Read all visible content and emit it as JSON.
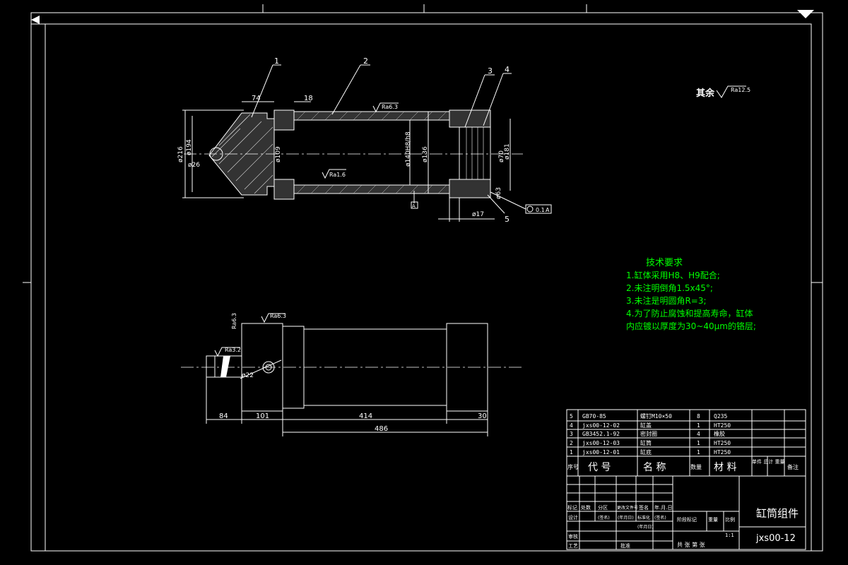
{
  "colors": {
    "background": "#000000",
    "line": "#ffffff",
    "leader": "#d0d0d0",
    "text": "#ffffff",
    "notes": "#00ff00"
  },
  "surface_note": {
    "label": "其余",
    "ra": "Ra12.5"
  },
  "balloons": [
    "1",
    "2",
    "3",
    "4",
    "5"
  ],
  "top_dims": [
    "74",
    "18"
  ],
  "diameters": {
    "d216": "ø216",
    "d194": "ø194",
    "d26": "ø26",
    "d109": "ø109",
    "d140": "ø140H8/h8",
    "d136": "ø136",
    "d70": "ø70",
    "d181": "ø181",
    "d17": "ø17",
    "d63": "ø63"
  },
  "roughness": {
    "r1": "Ra6.3",
    "r2": "Ra1.6",
    "r3": "Ra6.3",
    "r4": "Ra6.3",
    "r5": "Ra3.2"
  },
  "datum": {
    "letter": "A",
    "tolerance": "0.1",
    "ref": "A"
  },
  "bottom_dims": {
    "d22": "ø22",
    "l84": "84",
    "l101": "101",
    "l414": "414",
    "l486": "486",
    "l30": "30"
  },
  "tech_title": "技术要求",
  "tech_notes": [
    "1.缸体采用H8、H9配合;",
    "2.未注明倒角1.5x45°;",
    "3.未注是明圆角R=3;",
    "4.为了防止腐蚀和提高寿命，缸体",
    "   内应镀以厚度为30~40μm的铬层;"
  ],
  "bom_rows": [
    {
      "no": "5",
      "code": "GB70-85",
      "name": "螺钉M10×50",
      "qty": "8",
      "material": "Q235"
    },
    {
      "no": "4",
      "code": "jxs00-12-02",
      "name": "缸盖",
      "qty": "1",
      "material": "HT250"
    },
    {
      "no": "3",
      "code": "GB3452.1-92",
      "name": "密封圈",
      "qty": "4",
      "material": "橡胶"
    },
    {
      "no": "2",
      "code": "jxs00-12-03",
      "name": "缸筒",
      "qty": "1",
      "material": "HT250"
    },
    {
      "no": "1",
      "code": "jxs00-12-01",
      "name": "缸底",
      "qty": "1",
      "material": "HT250"
    }
  ],
  "bom_header": {
    "no": "序号",
    "code": "代  号",
    "name": "名  称",
    "qty": "数量",
    "material": "材  料",
    "weight": "单件 总计 重量",
    "remark": "备注"
  },
  "title_block": {
    "labels": [
      "标记",
      "处数",
      "分区",
      "更改文件号",
      "签名",
      "年.月.日"
    ],
    "labels2": [
      "设计",
      "(签名)",
      "(年月日)",
      "标准化",
      "(签名)",
      "(年月日)"
    ],
    "labels3": [
      "审核",
      "工艺",
      "批准"
    ],
    "stage": "阶段标记",
    "weight": "重量",
    "scale_label": "比例",
    "scale": "1:1",
    "sheets": "共  张  第  张",
    "name": "缸筒组件",
    "code": "jxs00-12"
  }
}
